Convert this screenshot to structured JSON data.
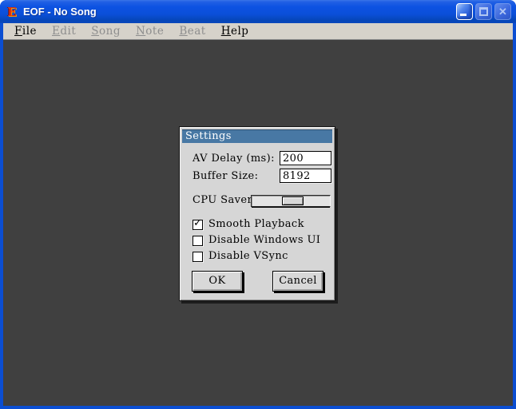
{
  "window": {
    "title": "EOF - No Song",
    "icon_letter": "E",
    "controls": {
      "minimize": "minimize",
      "maximize": "maximize",
      "close": "close"
    }
  },
  "menu": {
    "items": [
      {
        "label": "File",
        "enabled": true
      },
      {
        "label": "Edit",
        "enabled": false
      },
      {
        "label": "Song",
        "enabled": false
      },
      {
        "label": "Note",
        "enabled": false
      },
      {
        "label": "Beat",
        "enabled": false
      },
      {
        "label": "Help",
        "enabled": true
      }
    ]
  },
  "dialog": {
    "title": "Settings",
    "fields": [
      {
        "label": "AV Delay (ms):",
        "value": "200"
      },
      {
        "label": "Buffer Size:",
        "value": "8192"
      }
    ],
    "slider": {
      "label": "CPU Saver",
      "value_pct": 55
    },
    "checkboxes": [
      {
        "label": "Smooth Playback",
        "checked": true
      },
      {
        "label": "Disable Windows UI",
        "checked": false
      },
      {
        "label": "Disable VSync",
        "checked": false
      }
    ],
    "buttons": [
      {
        "label": "OK"
      },
      {
        "label": "Cancel"
      }
    ]
  },
  "icons": {
    "check": "✓",
    "close_glyph": "✕"
  },
  "colors": {
    "titlebar_blue": "#0c52e2",
    "dialog_title_blue": "#4878a4",
    "client_bg": "#404040",
    "menu_bg": "#d6d2ca",
    "dialog_bg": "#d6d6d6"
  }
}
